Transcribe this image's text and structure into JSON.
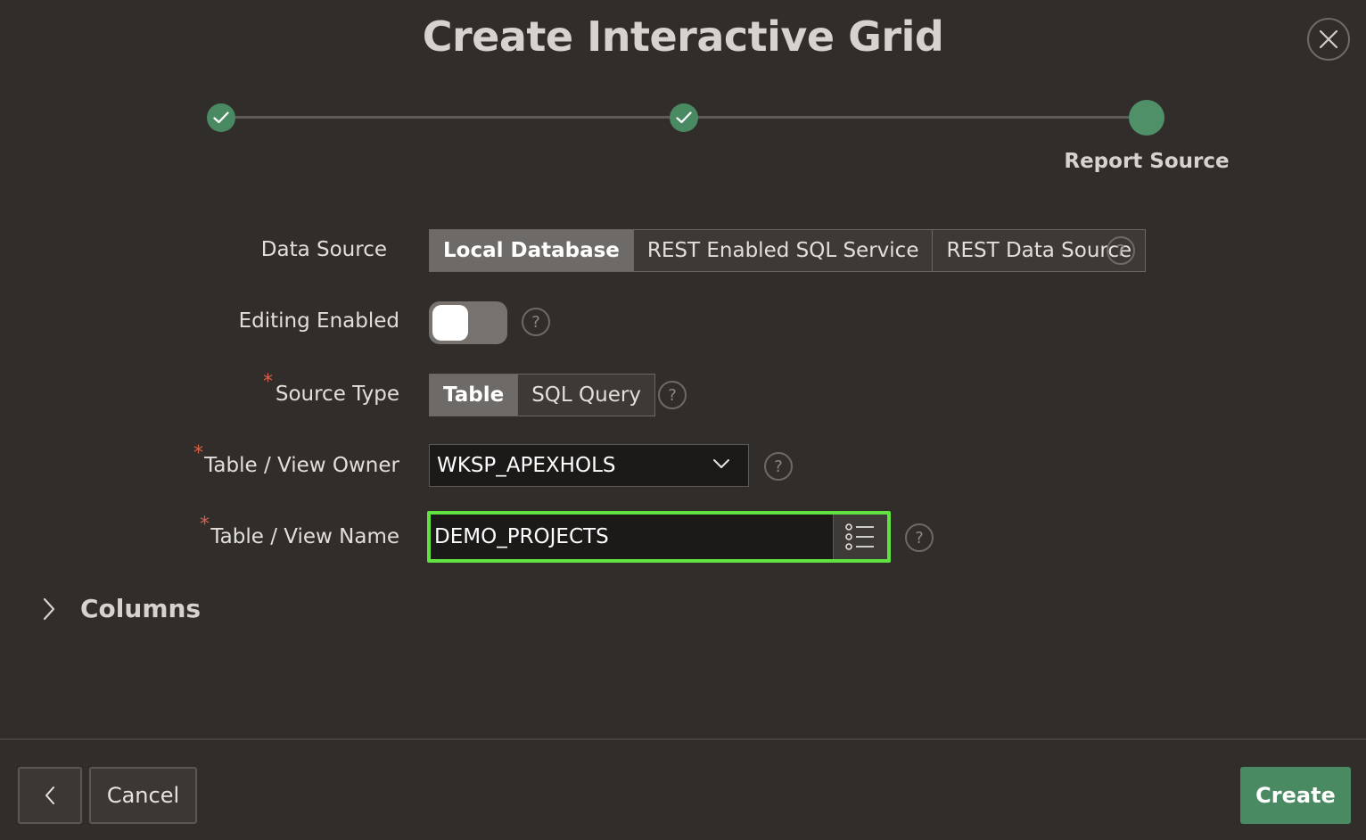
{
  "dialog": {
    "title": "Create Interactive Grid",
    "close_icon": "close-icon"
  },
  "progress": {
    "steps": [
      {
        "state": "complete",
        "icon": "check-icon"
      },
      {
        "state": "complete",
        "icon": "check-icon"
      },
      {
        "state": "current",
        "label": "Report Source"
      }
    ]
  },
  "form": {
    "data_source": {
      "label": "Data Source",
      "options": [
        "Local Database",
        "REST Enabled SQL Service",
        "REST Data Source"
      ],
      "selected": "Local Database"
    },
    "editing_enabled": {
      "label": "Editing Enabled",
      "value": false
    },
    "source_type": {
      "label": "Source Type",
      "required": "*",
      "options": [
        "Table",
        "SQL Query"
      ],
      "selected": "Table"
    },
    "table_owner": {
      "label": "Table / View Owner",
      "required": "*",
      "value": "WKSP_APEXHOLS"
    },
    "table_name": {
      "label": "Table / View Name",
      "required": "*",
      "value": "DEMO_PROJECTS"
    },
    "help_glyph": "?"
  },
  "columns_section": {
    "label": "Columns",
    "icon": "chevron-right-icon"
  },
  "footer": {
    "cancel_label": "Cancel",
    "create_label": "Create",
    "back_icon": "chevron-left-icon"
  },
  "colors": {
    "background": "#312d2a",
    "accent_green": "#4a8a63",
    "highlight_border": "#62e241",
    "required": "#d8614a"
  }
}
